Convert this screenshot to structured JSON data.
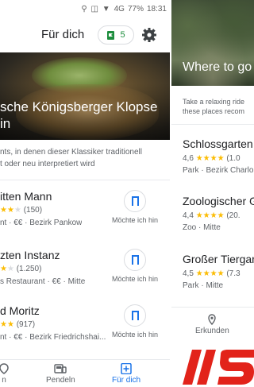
{
  "status_bar": {
    "network": "4G",
    "battery": "77%",
    "time": "18:31"
  },
  "left": {
    "appbar": {
      "title": "Für dich",
      "saved_count": "5"
    },
    "hero": {
      "title_line1": "sche Königsberger Klopse",
      "title_line2": "in"
    },
    "description": {
      "line1": "nts, in denen dieser Klassiker traditionell",
      "line2": "t oder neu interpretiert wird"
    },
    "restaurants": [
      {
        "name": "itten Mann",
        "stars": "★★",
        "stars_off": "★",
        "reviews": "(150)",
        "meta": "nt · €€ · Bezirk Pankow",
        "want": "Möchte ich hin"
      },
      {
        "name": "zten Instanz",
        "stars": "★",
        "stars_off": "★",
        "reviews": "(1.250)",
        "meta": "s Restaurant · €€ · Mitte",
        "want": "Möchte ich hin"
      },
      {
        "name": "d Moritz",
        "stars": "★★",
        "stars_off": "",
        "reviews": "(917)",
        "meta": "nt · €€ · Bezirk Friedrichshai...",
        "want": "Möchte ich hin"
      }
    ],
    "bottom_nav": [
      {
        "label": "n",
        "icon": "explore-icon"
      },
      {
        "label": "Pendeln",
        "icon": "commute-icon"
      },
      {
        "label": "Für dich",
        "icon": "for-you-icon"
      }
    ]
  },
  "right": {
    "hero_title": "Where to go",
    "description": {
      "line1": "Take a relaxing ride",
      "line2": "these places recom"
    },
    "places": [
      {
        "name": "Schlossgarten",
        "rating": "4,6",
        "stars": "★★★★",
        "reviews": "(1.0",
        "type": "Park · Bezirk Charlo"
      },
      {
        "name": "Zoologischer G",
        "rating": "4,4",
        "stars": "★★★★",
        "reviews": "(20.",
        "type": "Zoo · Mitte"
      },
      {
        "name": "Großer Tiergar",
        "rating": "4,5",
        "stars": "★★★★",
        "reviews": "(7.3",
        "type": "Park · Mitte"
      }
    ],
    "nav_label": "Erkunden"
  },
  "colors": {
    "accent": "#1a73e8",
    "saved_green": "#1e8e3e",
    "star": "#fbbc04",
    "logo_red": "#e2231a"
  }
}
